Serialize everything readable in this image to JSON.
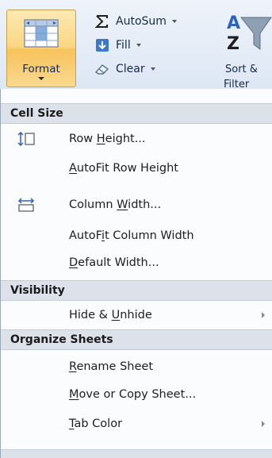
{
  "ribbon": {
    "format": {
      "label": "Format",
      "icon": "format-cells-icon"
    },
    "autosum": {
      "label": "AutoSum",
      "icon": "sigma-icon"
    },
    "fill": {
      "label": "Fill",
      "icon": "fill-down-arrow-icon"
    },
    "clear": {
      "label": "Clear",
      "icon": "eraser-icon"
    },
    "sort_filter": {
      "label_line1": "Sort &",
      "label_line2": "Filter"
    }
  },
  "menu": {
    "sections": [
      {
        "label": "Cell Size"
      },
      {
        "label": "Visibility"
      },
      {
        "label": "Organize Sheets"
      }
    ],
    "items": {
      "row_height": {
        "pre": "Row ",
        "key": "H",
        "post": "eight...",
        "icon": "row-height-icon"
      },
      "autofit_row": {
        "pre": "",
        "key": "A",
        "post": "utoFit Row Height"
      },
      "column_width": {
        "pre": "Column ",
        "key": "W",
        "post": "idth...",
        "icon": "column-width-icon"
      },
      "autofit_column": {
        "pre": "AutoF",
        "key": "i",
        "post": "t Column Width"
      },
      "default_width": {
        "pre": "",
        "key": "D",
        "post": "efault Width..."
      },
      "hide_unhide": {
        "pre": "Hide & ",
        "key": "U",
        "post": "nhide"
      },
      "rename_sheet": {
        "pre": "",
        "key": "R",
        "post": "ename Sheet"
      },
      "move_copy": {
        "pre": "",
        "key": "M",
        "post": "ove or Copy Sheet..."
      },
      "tab_color": {
        "pre": "",
        "key": "T",
        "post": "ab Color"
      }
    }
  },
  "colors": {
    "format_highlight": "#fbd684",
    "ribbon_bg": "#dde7f4",
    "section_bg": "#dde2ea",
    "menu_bg": "#fbfcfe"
  }
}
